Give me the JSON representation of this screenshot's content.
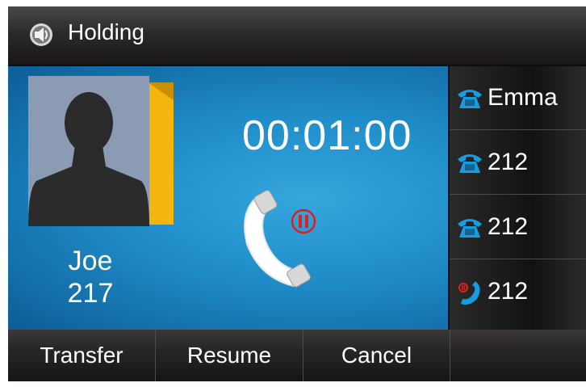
{
  "status_bar": {
    "title": "Holding",
    "icon": "speaker-icon"
  },
  "call": {
    "name": "Joe",
    "number": "217",
    "duration": "00:01:00",
    "state_icon": "handset-on-hold-icon"
  },
  "lines": [
    {
      "label": "Emma",
      "icon": "phone-icon"
    },
    {
      "label": "212",
      "icon": "phone-icon"
    },
    {
      "label": "212",
      "icon": "phone-icon"
    },
    {
      "label": "212",
      "icon": "handset-hold-icon"
    }
  ],
  "softkeys": [
    "Transfer",
    "Resume",
    "Cancel",
    ""
  ],
  "colors": {
    "accent": "#1f8cc8",
    "hold_red": "#e02020",
    "line_icon": "#1a9be0",
    "avatar_tab": "#f5b50f"
  }
}
